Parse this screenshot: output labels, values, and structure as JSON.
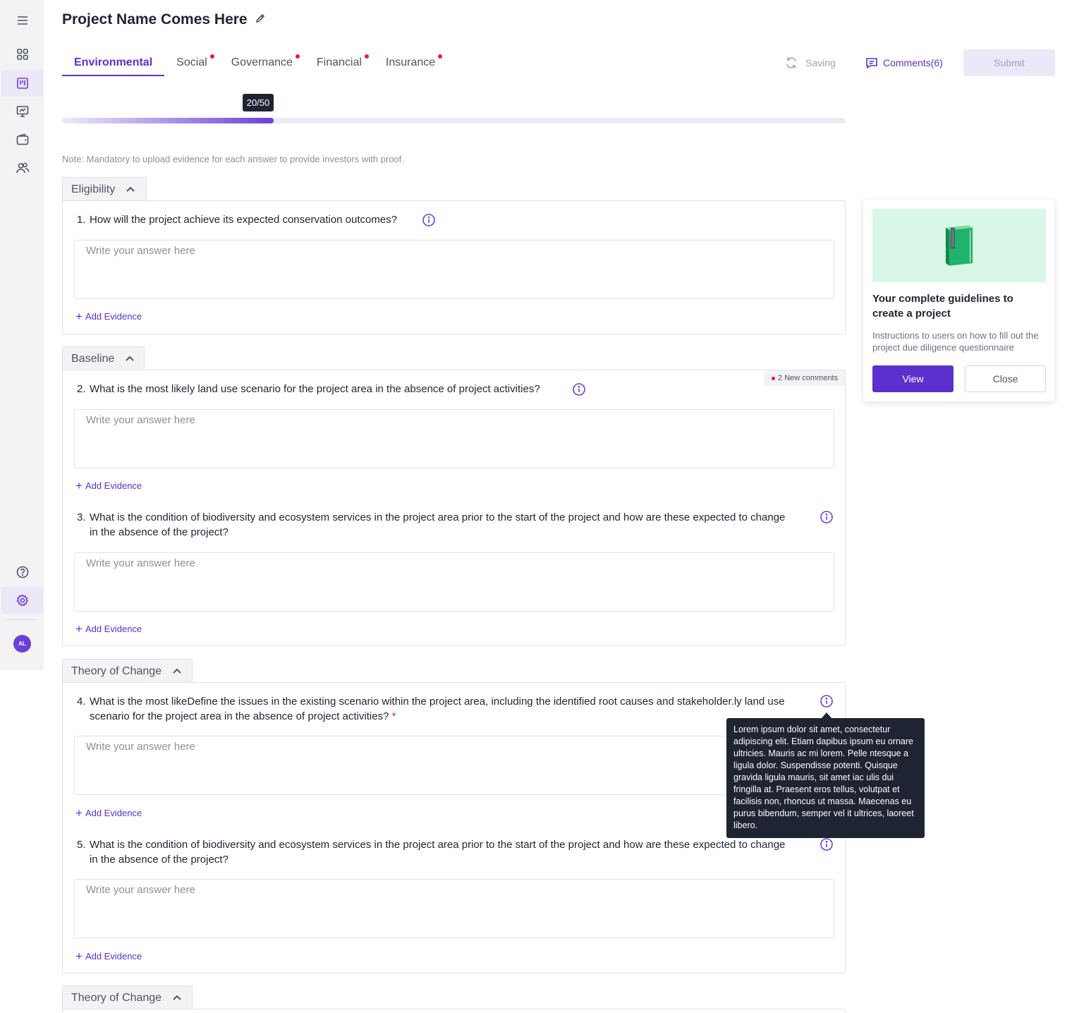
{
  "sidebar": {
    "menu_icon": "hamburger-menu-icon",
    "items": [
      {
        "icon": "dashboard-grid-icon"
      },
      {
        "icon": "projects-board-icon"
      },
      {
        "icon": "presentation-chart-icon"
      },
      {
        "icon": "wallet-icon"
      },
      {
        "icon": "users-icon"
      }
    ],
    "help_icon": "help-circle-icon",
    "settings_icon": "gear-icon",
    "avatar_initials": "AL"
  },
  "header": {
    "title": "Project Name Comes Here",
    "tabs": [
      {
        "label": "Environmental",
        "active": true,
        "dot": false
      },
      {
        "label": "Social",
        "active": false,
        "dot": true
      },
      {
        "label": "Governance",
        "active": false,
        "dot": true
      },
      {
        "label": "Financial",
        "active": false,
        "dot": true
      },
      {
        "label": "Insurance",
        "active": false,
        "dot": true
      }
    ],
    "saving_label": "Saving",
    "comments_label": "Comments(6)",
    "submit_label": "Submit"
  },
  "progress": {
    "label": "20/50",
    "fraction": 0.27
  },
  "note": "Note: Mandatory to upload evidence for each answer to provide investors with proof.",
  "sections": [
    {
      "title": "Eligibility",
      "questions": [
        {
          "num": "1.",
          "text": "How will the project achieve its expected conservation outcomes?",
          "placeholder": "Write your answer here",
          "add_evidence": "Add Evidence"
        }
      ]
    },
    {
      "title": "Baseline",
      "new_comments": "2 New comments",
      "questions": [
        {
          "num": "2.",
          "text": "What is the most likely land use scenario for the project area in the absence of project activities?",
          "placeholder": "Write your answer here",
          "add_evidence": "Add Evidence"
        },
        {
          "num": "3.",
          "text": "What is the condition of biodiversity and ecosystem services in the project area prior to the start of the project and how are these expected to change in the absence of the project?",
          "placeholder": "Write your answer here",
          "add_evidence": "Add Evidence"
        }
      ]
    },
    {
      "title": "Theory of Change",
      "questions": [
        {
          "num": "4.",
          "text": "What is the most likeDefine the issues in the existing scenario within the project area, including the identified root causes and stakeholder.ly land use scenario for the project area in the absence of project activities?",
          "required": "*",
          "placeholder": "Write your answer here",
          "add_evidence": "Add Evidence"
        },
        {
          "num": "5.",
          "text": "What is the condition of biodiversity and ecosystem services in the project area prior to the start of the project and how are these expected to change in the absence of the project?",
          "placeholder": "Write your answer here",
          "add_evidence": "Add Evidence"
        }
      ]
    },
    {
      "title": "Theory of Change"
    }
  ],
  "tooltip": "Lorem ipsum dolor sit amet, consectetur adipiscing elit. Etiam dapibus ipsum eu ornare ultricies. Mauris ac mi lorem. Pelle ntesque a ligula dolor. Suspendisse potenti. Quisque gravida ligula mauris, sit amet iac ulis dui fringilla at. Praesent eros tellus, volutpat et facilisis non, rhoncus ut massa. Maecenas eu purus bibendum, semper vel it ultrices, laoreet libero.",
  "guide_card": {
    "image_icon": "green-binder-icon",
    "title": "Your complete guidelines to create a project",
    "description": "Instructions to users on how to fill out the project due diligence questionnaire",
    "view_label": "View",
    "close_label": "Close"
  },
  "colors": {
    "accent": "#5b30cc",
    "dot": "#e11d48",
    "tooltip_bg": "#1f2433",
    "card_image_bg": "#d9f7e6"
  }
}
